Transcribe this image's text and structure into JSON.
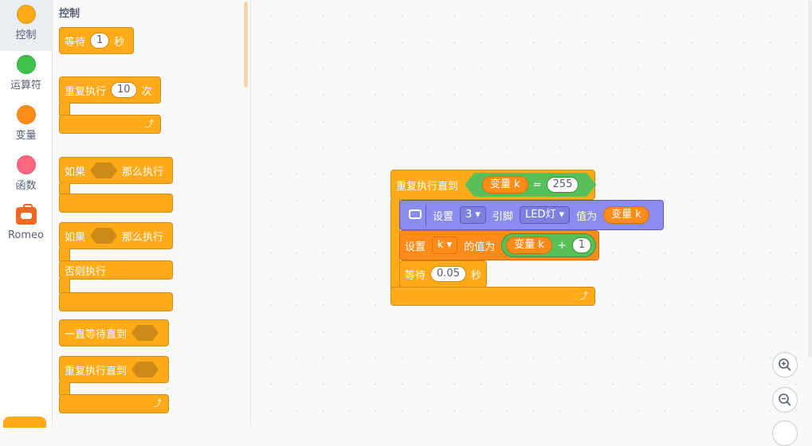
{
  "categories": [
    {
      "label": "控制",
      "color": "#ffab19",
      "active": true
    },
    {
      "label": "运算符",
      "color": "#40bf4a",
      "active": false
    },
    {
      "label": "变量",
      "color": "#ff8c1a",
      "active": false
    },
    {
      "label": "函数",
      "color": "#ff6680",
      "active": false
    },
    {
      "label": "Romeo",
      "icon": "robot-icon",
      "active": false
    }
  ],
  "flyout": {
    "title": "控制",
    "wait": {
      "label": "等待",
      "value": "1",
      "unit": "秒"
    },
    "repeat": {
      "label": "重复执行",
      "value": "10",
      "unit": "次"
    },
    "if_then": {
      "label_if": "如果",
      "label_then": "那么执行"
    },
    "if_else": {
      "label_if": "如果",
      "label_then": "那么执行",
      "label_else": "否则执行"
    },
    "wait_until": {
      "label": "一直等待直到"
    },
    "repeat_until": {
      "label": "重复执行直到"
    }
  },
  "script": {
    "repeat_until": {
      "label": "重复执行直到",
      "var": "变量 k",
      "op": "=",
      "value": "255"
    },
    "set_pin": {
      "label_set": "设置",
      "pin": "3",
      "label_pin": "引脚",
      "device": "LED灯",
      "label_value": "值为",
      "var": "变量 k"
    },
    "set_var": {
      "label_set": "设置",
      "var_name": "k",
      "label_value": "的值为",
      "var": "变量 k",
      "op": "+",
      "value": "1"
    },
    "wait": {
      "label": "等待",
      "value": "0.05",
      "unit": "秒"
    }
  },
  "zoom": {
    "in": "zoom-in-icon",
    "out": "zoom-out-icon"
  }
}
